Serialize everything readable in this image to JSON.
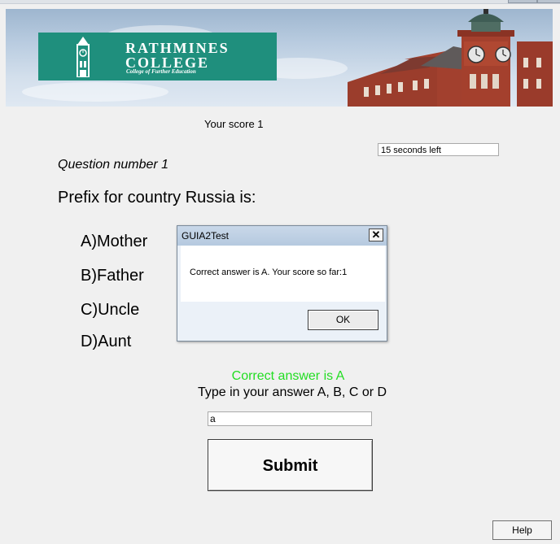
{
  "banner": {
    "college_name_line1": "RATHMINES",
    "college_name_line2": "COLLEGE",
    "college_tagline": "College of Further Education"
  },
  "quiz": {
    "score_label": "Your score 1",
    "timer_text": "15 seconds left",
    "question_number": "Question number 1",
    "question_text": "Prefix for country Russia is:",
    "options": [
      "A)Mother",
      "B)Father",
      "C)Uncle",
      "D)Aunt"
    ],
    "feedback": "Correct answer is A",
    "instruction": "Type in your answer A, B, C or D",
    "answer_value": "a",
    "submit_label": "Submit",
    "help_label": "Help"
  },
  "dialog": {
    "title": "GUIA2Test",
    "close_glyph": "✕",
    "message": "Correct answer is A. Your score so far:1",
    "ok_label": "OK"
  },
  "colors": {
    "logo_teal": "#1f8f7d",
    "feedback_green": "#22dd22",
    "brick_red": "#a2402e"
  }
}
